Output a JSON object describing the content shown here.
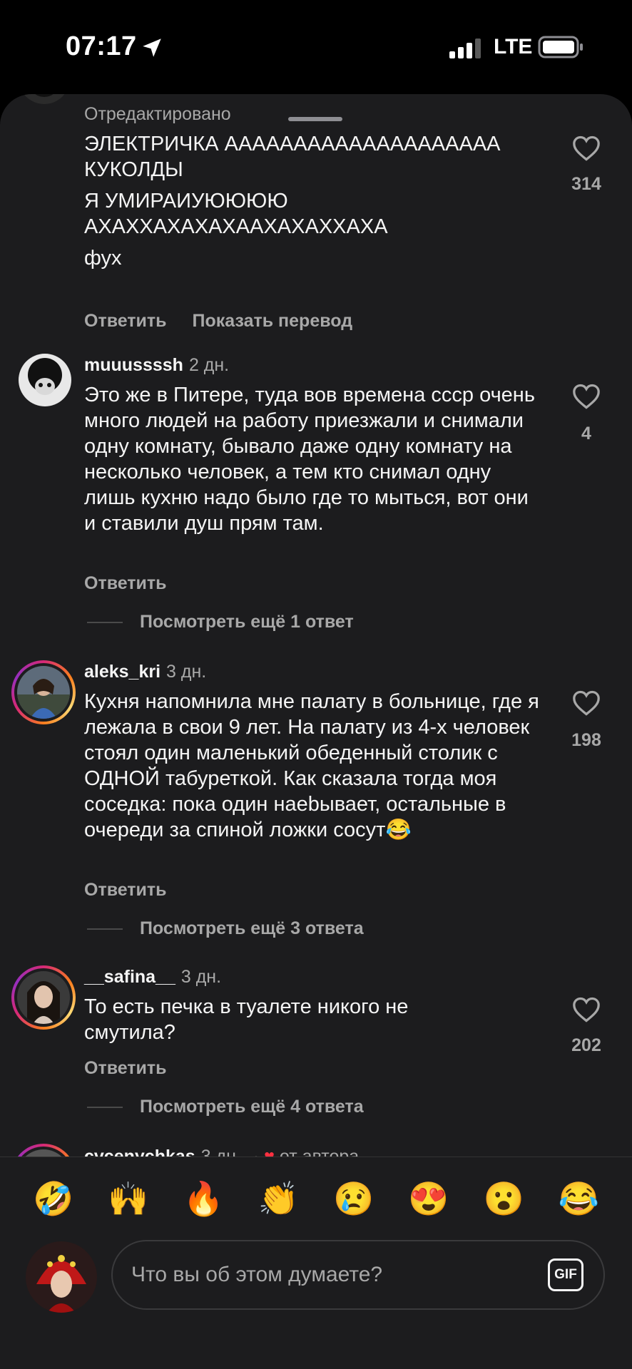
{
  "status_bar": {
    "time": "07:17",
    "network": "LTE"
  },
  "comments": [
    {
      "edited_label": "Отредактировано",
      "paragraphs": [
        "ЭЛЕКТРИЧКА АААААААААААААААААААА КУКОЛДЫ",
        "Я УМИРАИУЮЮЮЮ АХАХХАХАХАХААХАХАХХАХА",
        "фух"
      ],
      "reply_label": "Ответить",
      "translate_label": "Показать перевод",
      "likes": "314"
    },
    {
      "username": "muuussssh",
      "time": "2 дн.",
      "text": "Это же в Питере, туда вов времена ссср очень много людей на работу приезжали и снимали одну комнату, бывало даже одну комнату на несколько человек, а тем кто снимал одну лишь кухню надо было где то мыться, вот они и ставили душ прям там.",
      "reply_label": "Ответить",
      "more_replies": "Посмотреть ещё 1 ответ",
      "likes": "4"
    },
    {
      "username": "aleks_kri",
      "time": "3 дн.",
      "text": "Кухня напомнила мне палату в больнице, где я лежала в свои 9 лет. На палату из 4-х человек стоял один маленький обеденный столик с ОДНОЙ табуреткой. Как сказала тогда моя соседка: пока один наеbывает, остальные в очереди за спиной ложки сосут😂",
      "reply_label": "Ответить",
      "more_replies": "Посмотреть ещё 3 ответа",
      "likes": "198"
    },
    {
      "username": "__safina__",
      "time": "3 дн.",
      "text": "То есть печка в туалете никого не смутила?",
      "reply_label": "Ответить",
      "more_replies": "Посмотреть ещё 4 ответа",
      "likes": "202"
    },
    {
      "username": "cvcenychkas",
      "time": "3 дн.",
      "author_like": "от автора"
    }
  ],
  "quick_reactions": [
    "🤣",
    "🙌",
    "🔥",
    "👏",
    "😢",
    "😍",
    "😮",
    "😂"
  ],
  "composer": {
    "placeholder": "Что вы об этом думаете?",
    "gif_label": "GIF"
  },
  "icons": {
    "location": "location-arrow-icon",
    "signal": "cellular-signal-icon",
    "battery": "battery-icon",
    "like": "heart-outline-icon"
  }
}
